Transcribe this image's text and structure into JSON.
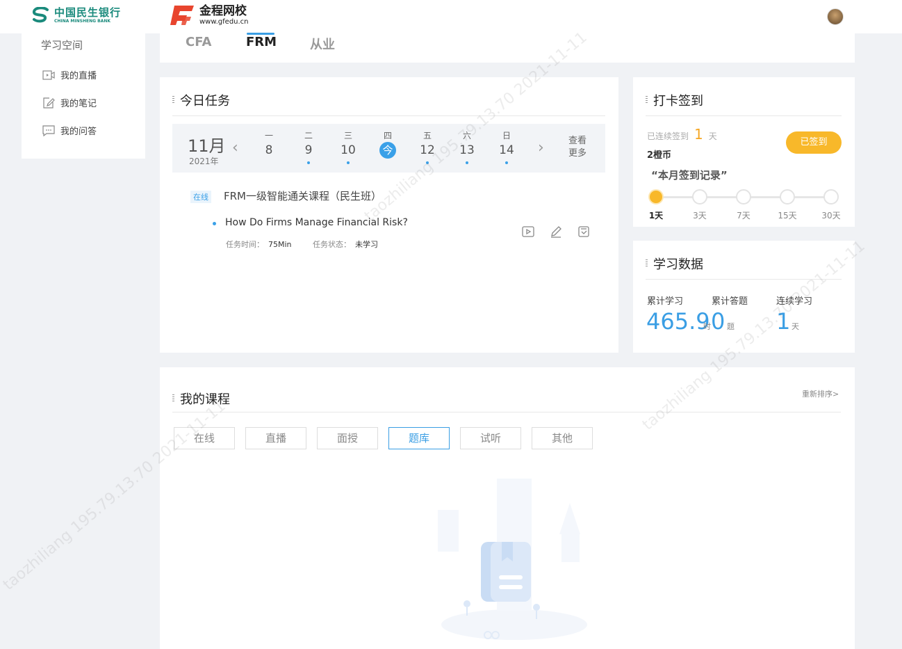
{
  "header": {
    "bank_logo_cn": "中国民生银行",
    "bank_logo_en": "CHINA MINSHENG BANK",
    "school_logo_cn": "金程网校",
    "school_url": "www.gfedu.cn"
  },
  "sidebar": {
    "title": "学习空间",
    "items": [
      {
        "label": "我的直播",
        "icon": "video-icon"
      },
      {
        "label": "我的笔记",
        "icon": "note-icon"
      },
      {
        "label": "我的问答",
        "icon": "chat-icon"
      }
    ]
  },
  "tabs": [
    {
      "label": "CFA"
    },
    {
      "label": "FRM"
    },
    {
      "label": "从业"
    }
  ],
  "active_tab": "FRM",
  "today_tasks": {
    "title": "今日任务",
    "month": "11月",
    "year": "2021年",
    "days": [
      {
        "week": "一",
        "num": "8"
      },
      {
        "week": "二",
        "num": "9"
      },
      {
        "week": "三",
        "num": "10"
      },
      {
        "week": "四",
        "num": "今"
      },
      {
        "week": "五",
        "num": "12"
      },
      {
        "week": "六",
        "num": "13"
      },
      {
        "week": "日",
        "num": "14"
      }
    ],
    "more_line1": "查看",
    "more_line2": "更多",
    "course_tag": "在线",
    "course_name": "FRM一级智能通关课程（民生班）",
    "lesson_name": "How Do Firms Manage Financial Risk?",
    "time_label": "任务时间：",
    "time_value": "75Min",
    "status_label": "任务状态：",
    "status_value": "未学习"
  },
  "checkin": {
    "title": "打卡签到",
    "streak_label": "已连续签到",
    "streak_value": "1",
    "streak_unit": "天",
    "coins": "2橙币",
    "signed_button": "已签到",
    "month_record": "“本月签到记录”",
    "milestones": [
      "1天",
      "3天",
      "7天",
      "15天",
      "30天"
    ]
  },
  "study_data": {
    "title": "学习数据",
    "total_study_label": "累计学习",
    "total_study_value": "465.9",
    "total_study_unit": "时",
    "total_answer_label": "累计答题",
    "total_answer_value": "0",
    "total_answer_unit": "题",
    "streak_label": "连续学习",
    "streak_value": "1",
    "streak_unit": "天"
  },
  "my_courses": {
    "title": "我的课程",
    "resort": "重新排序>",
    "tabs": [
      "在线",
      "直播",
      "面授",
      "题库",
      "试听",
      "其他"
    ],
    "active": "题库"
  },
  "watermark": "taozhiliang 195.79.13.70 2021-11-11",
  "colors": {
    "accent": "#3a9ee4",
    "sign": "#f8b82a",
    "bank": "#1a8a7c",
    "school": "#e8452e"
  }
}
